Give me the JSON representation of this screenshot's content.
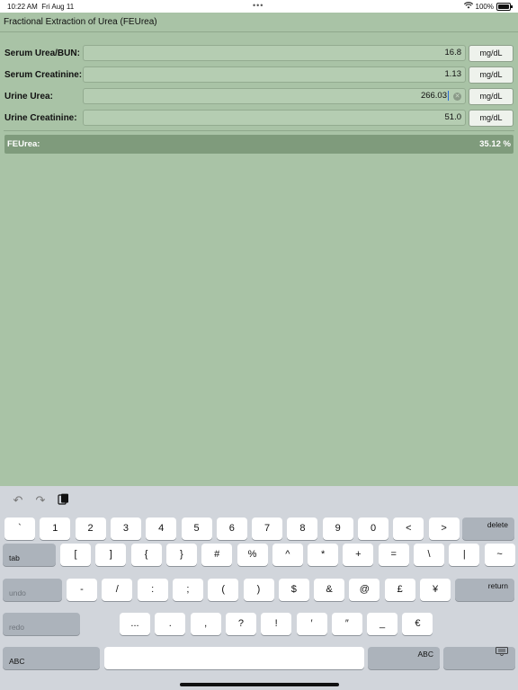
{
  "status": {
    "time": "10:22 AM",
    "date": "Fri Aug 11",
    "battery": "100%"
  },
  "title": "Fractional Extraction of Urea (FEUrea)",
  "fields": [
    {
      "label": "Serum Urea/BUN:",
      "value": "16.8",
      "unit": "mg/dL"
    },
    {
      "label": "Serum Creatinine:",
      "value": "1.13",
      "unit": "mg/dL"
    },
    {
      "label": "Urine Urea:",
      "value": "266.03",
      "unit": "mg/dL"
    },
    {
      "label": "Urine Creatinine:",
      "value": "51.0",
      "unit": "mg/dL"
    }
  ],
  "result": {
    "label": "FEUrea:",
    "value": "35.12 %"
  },
  "keyboard": {
    "row1": [
      "`",
      "1",
      "2",
      "3",
      "4",
      "5",
      "6",
      "7",
      "8",
      "9",
      "0",
      "<",
      ">"
    ],
    "delete": "delete",
    "tab": "tab",
    "row2": [
      "[",
      "]",
      "{",
      "}",
      "#",
      "%",
      "^",
      "*",
      "+",
      "=",
      "\\",
      "|",
      "~"
    ],
    "undo": "undo",
    "row3": [
      "-",
      "/",
      ":",
      ";",
      "(",
      ")",
      "$",
      "&",
      "@",
      "£",
      "¥"
    ],
    "return": "return",
    "redo": "redo",
    "row4": [
      "...",
      ".",
      ",",
      "?",
      "!",
      "′",
      "″",
      "_",
      "€"
    ],
    "abc_left": "ABC",
    "abc_right": "ABC"
  }
}
